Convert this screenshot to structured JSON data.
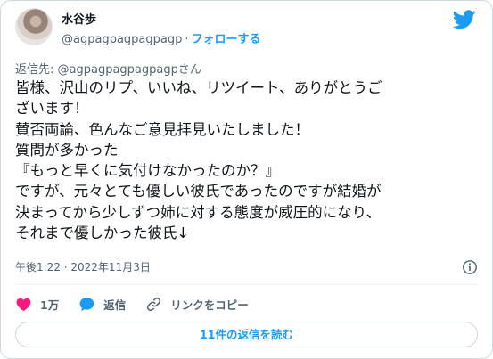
{
  "header": {
    "display_name": "水谷歩",
    "handle": "@agpagpagpagpagp",
    "separator": "·",
    "follow_label": "フォローする"
  },
  "reply_to": "返信先: @agpagpagpagpagpさん",
  "tweet_text": "皆様、沢山のリプ、いいね、リツイート、ありがとうご\nざいます！\n賛否両論、色んなご意見拝見いたしました！\n質問が多かった\n『もっと早くに気付けなかったのか？』\nですが、元々とても優しい彼氏であったのですが結婚が\n決まってから少しずつ姉に対する態度が威圧的になり、\nそれまで優しかった彼氏↓",
  "timestamp": "午後1:22 · 2022年11月3日",
  "actions": {
    "like_count": "1万",
    "reply_label": "返信",
    "copy_link_label": "リンクをコピー"
  },
  "read_replies_label": "11件の返信を読む",
  "colors": {
    "accent": "#1d9bf0",
    "like": "#f91880",
    "secondary_text": "#536471"
  },
  "icons": [
    "avatar",
    "twitter-bird-icon",
    "info-icon",
    "heart-icon",
    "reply-bubble-icon",
    "link-icon"
  ]
}
